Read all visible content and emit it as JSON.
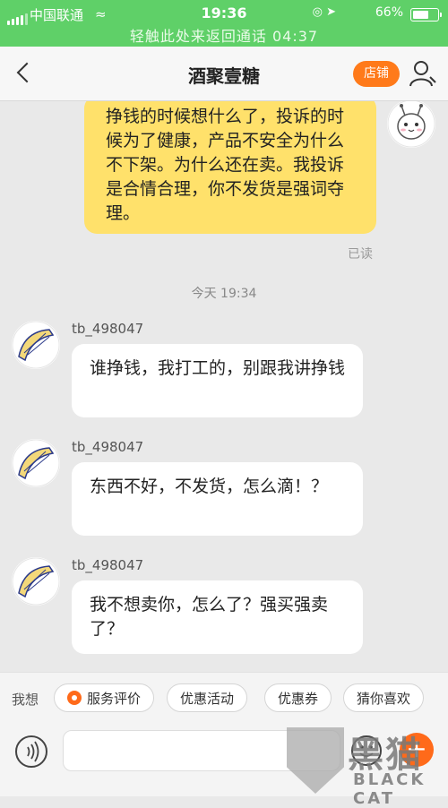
{
  "status_bar": {
    "carrier": "中国联通",
    "time": "19:36",
    "battery": "66%",
    "battery_level": 0.66,
    "call_banner": "轻触此处来返回通话 04:37"
  },
  "header": {
    "title": "酒聚壹糖",
    "shop_label": "店铺"
  },
  "chat": {
    "outgoing": {
      "text": "挣钱的时候想什么了，投诉的时候为了健康，产品不安全为什么不下架。为什么还在卖。我投诉是合情合理，你不发货是强词夺理。",
      "status": "已读"
    },
    "timestamp": "今天 19:34",
    "messages": [
      {
        "sender": "tb_498047",
        "text": "谁挣钱，我打工的，别跟我讲挣钱"
      },
      {
        "sender": "tb_498047",
        "text": "东西不好，不发货，怎么滴！？"
      },
      {
        "sender": "tb_498047",
        "text": "我不想卖你，怎么了？强买强卖了？"
      }
    ]
  },
  "quick_bar": {
    "label": "我想",
    "chips": [
      "服务评价",
      "优惠活动",
      "优惠券",
      "猜你喜欢"
    ]
  },
  "watermark": {
    "text": "黑猫",
    "subtext": "BLACK CAT"
  },
  "colors": {
    "status_bar": "#5fd068",
    "accent": "#ff7a1a",
    "outgoing_bubble": "#ffe16b",
    "background": "#e9e9e9"
  }
}
